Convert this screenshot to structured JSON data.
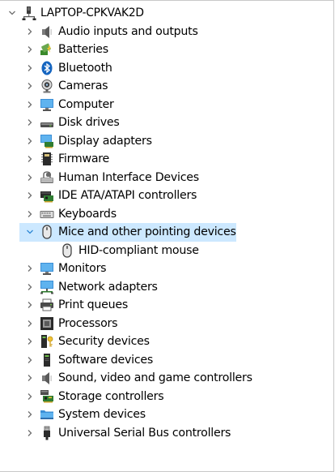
{
  "device_manager": {
    "root": {
      "label": "LAPTOP-CPKVAK2D",
      "expanded": true,
      "icon": "computer-tower-icon"
    },
    "categories": [
      {
        "id": "audio",
        "label": "Audio inputs and outputs",
        "icon": "speaker-icon",
        "expanded": false
      },
      {
        "id": "batteries",
        "label": "Batteries",
        "icon": "battery-icon",
        "expanded": false
      },
      {
        "id": "bluetooth",
        "label": "Bluetooth",
        "icon": "bluetooth-icon",
        "expanded": false
      },
      {
        "id": "cameras",
        "label": "Cameras",
        "icon": "camera-icon",
        "expanded": false
      },
      {
        "id": "computer",
        "label": "Computer",
        "icon": "monitor-icon",
        "expanded": false
      },
      {
        "id": "disk",
        "label": "Disk drives",
        "icon": "disk-drive-icon",
        "expanded": false
      },
      {
        "id": "display",
        "label": "Display adapters",
        "icon": "display-adapter-icon",
        "expanded": false
      },
      {
        "id": "firmware",
        "label": "Firmware",
        "icon": "chip-icon",
        "expanded": false
      },
      {
        "id": "hid",
        "label": "Human Interface Devices",
        "icon": "hid-icon",
        "expanded": false
      },
      {
        "id": "ide",
        "label": "IDE ATA/ATAPI controllers",
        "icon": "controller-card-icon",
        "expanded": false
      },
      {
        "id": "keyboards",
        "label": "Keyboards",
        "icon": "keyboard-icon",
        "expanded": false
      },
      {
        "id": "mice",
        "label": "Mice and other pointing devices",
        "icon": "mouse-icon",
        "expanded": true,
        "selected": true,
        "children": [
          {
            "label": "HID-compliant mouse",
            "icon": "mouse-icon"
          }
        ]
      },
      {
        "id": "monitors",
        "label": "Monitors",
        "icon": "monitor-icon",
        "expanded": false
      },
      {
        "id": "network",
        "label": "Network adapters",
        "icon": "network-adapter-icon",
        "expanded": false
      },
      {
        "id": "print",
        "label": "Print queues",
        "icon": "printer-icon",
        "expanded": false
      },
      {
        "id": "processors",
        "label": "Processors",
        "icon": "processor-icon",
        "expanded": false
      },
      {
        "id": "security",
        "label": "Security devices",
        "icon": "security-key-icon",
        "expanded": false
      },
      {
        "id": "software",
        "label": "Software devices",
        "icon": "software-device-icon",
        "expanded": false
      },
      {
        "id": "sound",
        "label": "Sound, video and game controllers",
        "icon": "speaker-icon",
        "expanded": false
      },
      {
        "id": "storage",
        "label": "Storage controllers",
        "icon": "storage-controller-icon",
        "expanded": false
      },
      {
        "id": "system",
        "label": "System devices",
        "icon": "system-folder-icon",
        "expanded": false
      },
      {
        "id": "usb",
        "label": "Universal Serial Bus controllers",
        "icon": "usb-plug-icon",
        "expanded": false
      }
    ]
  },
  "colors": {
    "selection": "#cce8ff",
    "chevron": "#6e6e6e",
    "text": "#000000"
  }
}
